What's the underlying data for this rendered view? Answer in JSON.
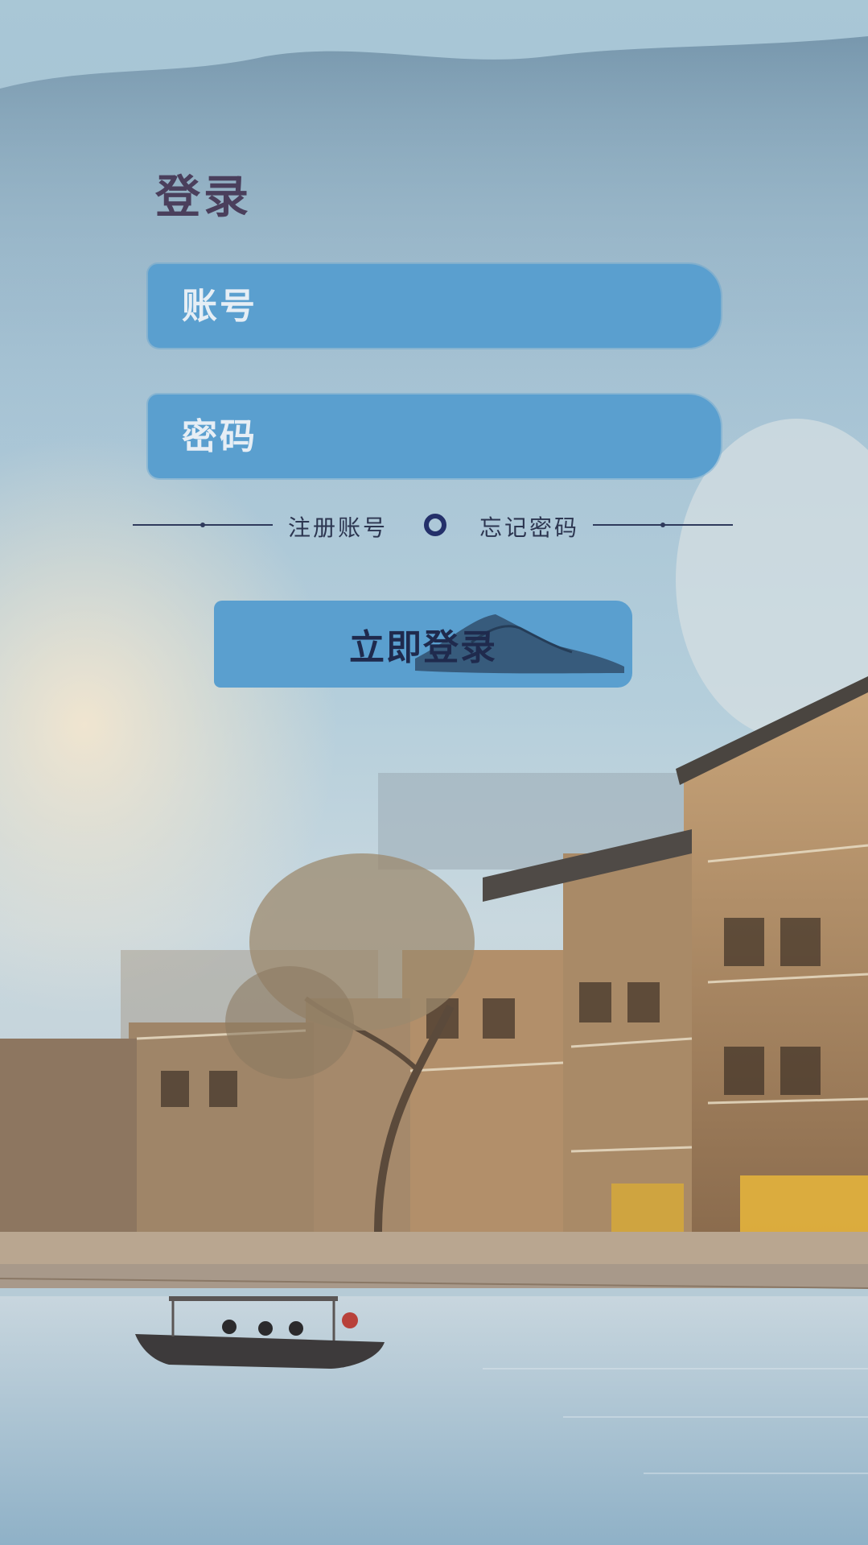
{
  "login": {
    "title": "登录",
    "account_placeholder": "账号",
    "password_placeholder": "密码",
    "register_link": "注册账号",
    "forgot_link": "忘记密码",
    "submit_label": "立即登录"
  },
  "colors": {
    "field_background": "#5a9fcf",
    "title_color": "#4a3f5c",
    "link_color": "#2c3550"
  }
}
